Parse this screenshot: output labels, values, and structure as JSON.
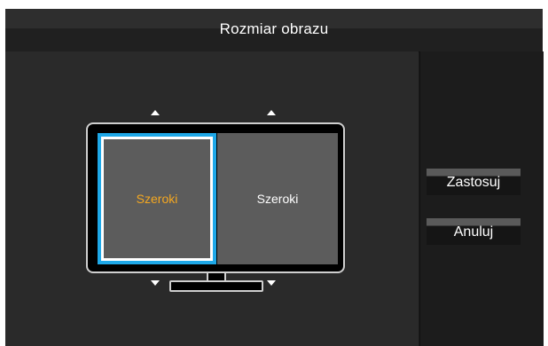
{
  "window": {
    "title": "Rozmiar obrazu"
  },
  "preview": {
    "left_screen_label": "Szeroki",
    "right_screen_label": "Szeroki",
    "selected": "left"
  },
  "actions": {
    "apply_label": "Zastosuj",
    "cancel_label": "Anuluj"
  },
  "colors": {
    "selection_border": "#1ea8e8",
    "selected_text": "#f5a820",
    "panel_background": "#2a2a2a"
  }
}
